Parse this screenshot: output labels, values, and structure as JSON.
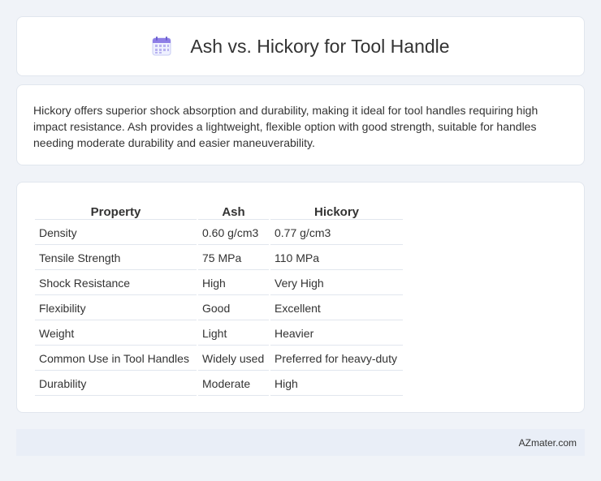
{
  "header": {
    "icon": "calendar-icon",
    "title": "Ash vs. Hickory for Tool Handle"
  },
  "summary": {
    "text": "Hickory offers superior shock absorption and durability, making it ideal for tool handles requiring high impact resistance. Ash provides a lightweight, flexible option with good strength, suitable for handles needing moderate durability and easier maneuverability."
  },
  "table": {
    "headers": [
      "Property",
      "Ash",
      "Hickory"
    ],
    "rows": [
      [
        "Density",
        "0.60 g/cm3",
        "0.77 g/cm3"
      ],
      [
        "Tensile Strength",
        "75 MPa",
        "110 MPa"
      ],
      [
        "Shock Resistance",
        "High",
        "Very High"
      ],
      [
        "Flexibility",
        "Good",
        "Excellent"
      ],
      [
        "Weight",
        "Light",
        "Heavier"
      ],
      [
        "Common Use in Tool Handles",
        "Widely used",
        "Preferred for heavy-duty"
      ],
      [
        "Durability",
        "Moderate",
        "High"
      ]
    ]
  },
  "footer": {
    "text": "AZmater.com"
  },
  "colors": {
    "background": "#f0f3f8",
    "card": "#ffffff",
    "footer": "#e9eef7",
    "icon_accent": "#8e7ee6"
  }
}
